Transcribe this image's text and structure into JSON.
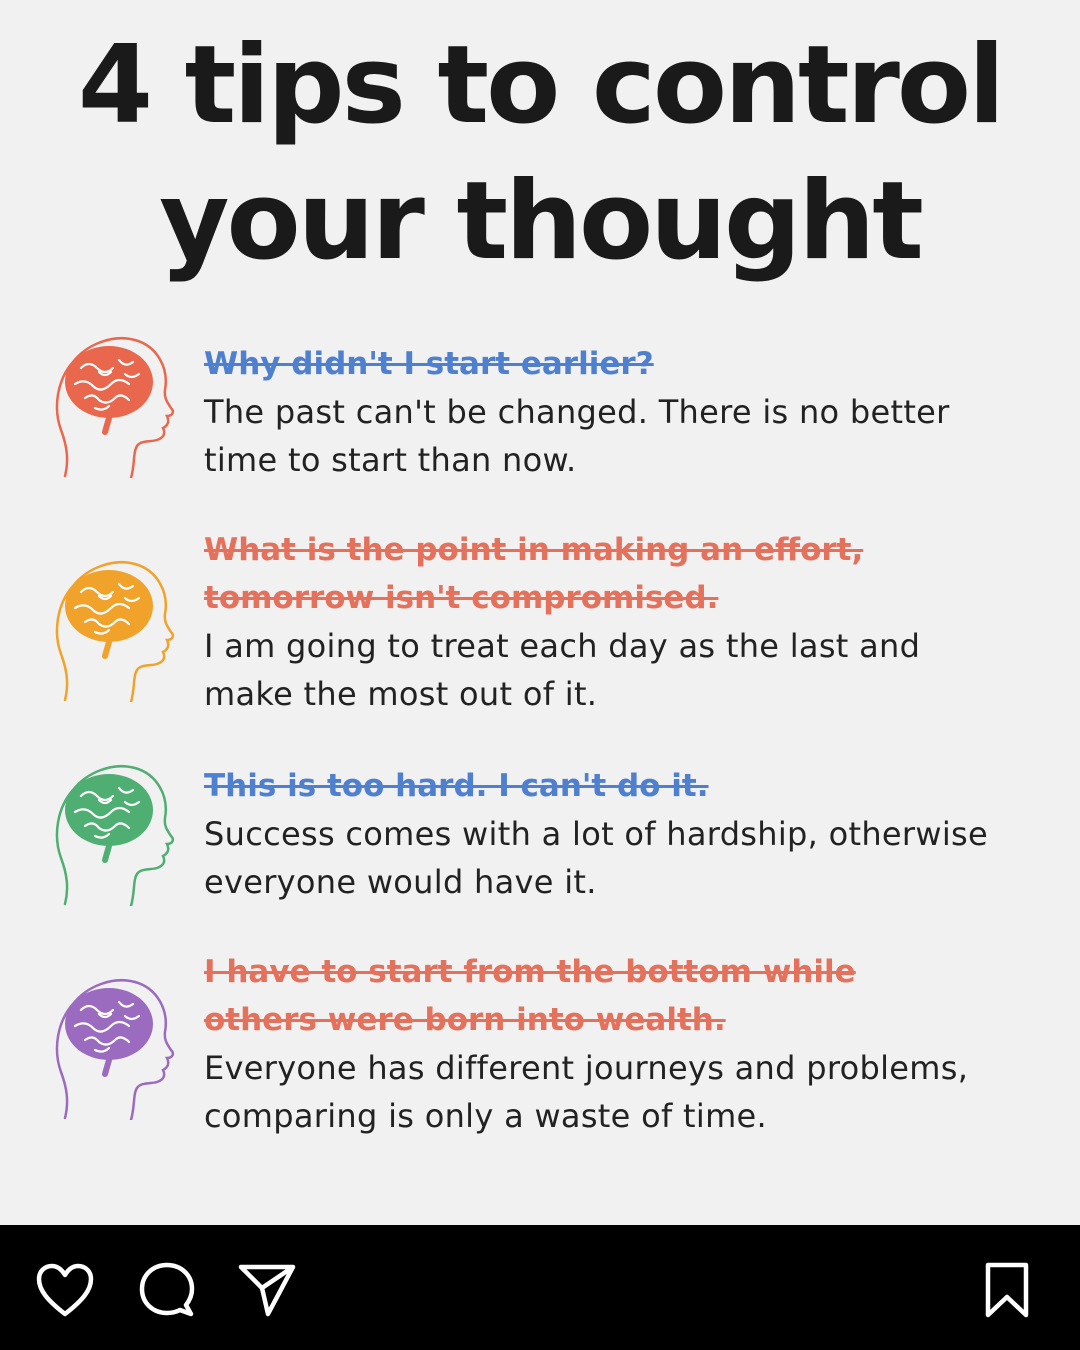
{
  "post": {
    "title": "4 tips to control\nyour thought",
    "tips": [
      {
        "old_thought": "Why didn't I start earlier?",
        "new_thought": "The past can't be changed. There is no better\ntime to start than now.",
        "icon": "head-brain-icon",
        "color": "#e9674c",
        "strike_color": "#4f7fcf"
      },
      {
        "old_thought": "What is the point in making an effort,\ntomorrow isn't compromised.",
        "new_thought": "I am going to treat each day as the last and\nmake the most out of it.",
        "icon": "head-brain-icon",
        "color": "#f0a22a",
        "strike_color": "#e4715b"
      },
      {
        "old_thought": "This is too hard. I can't do it.",
        "new_thought": "Success comes with a lot of hardship, otherwise\neveryone would have it.",
        "icon": "head-brain-icon",
        "color": "#4fae72",
        "strike_color": "#4f7fcf"
      },
      {
        "old_thought": "I have to start from the bottom while\nothers were born into wealth.",
        "new_thought": "Everyone has different journeys and problems,\ncomparing is only a waste of time.",
        "icon": "head-brain-icon",
        "color": "#9b6bc0",
        "strike_color": "#e4715b"
      }
    ]
  },
  "action_bar": {
    "background": "#000000",
    "icons": [
      "heart-icon",
      "comment-icon",
      "share-icon",
      "bookmark-icon"
    ]
  }
}
